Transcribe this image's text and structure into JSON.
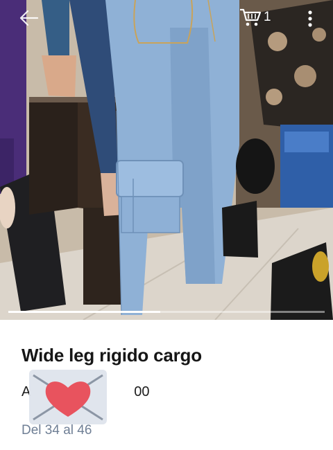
{
  "header": {
    "back_icon": "arrow-left-icon",
    "cart_icon": "shopping-cart-icon",
    "cart_count": "1",
    "menu_icon": "more-vertical-icon"
  },
  "gallery": {
    "image_description": "Light wash cargo jeans on a mannequin in a store",
    "progress": 0.48
  },
  "product": {
    "title": "Wide leg rigido cargo",
    "price": "A                           00",
    "sizes": "Del 34 al 46"
  },
  "overlay": {
    "favorite_icon": "envelope-heart-icon"
  },
  "colors": {
    "denim": "#8fb1d6",
    "heart": "#e8535e",
    "sizes_text": "#6f7f95"
  }
}
